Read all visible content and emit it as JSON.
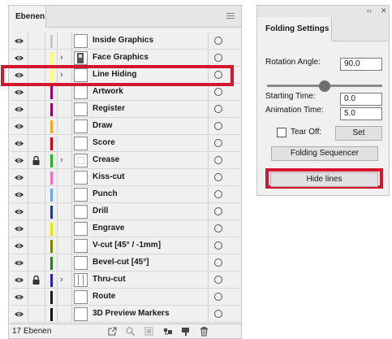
{
  "layers_panel": {
    "tab_label": "Ebenen",
    "menu_icon": "hamburger-icon",
    "layer_count": "17 Ebenen",
    "layers": [
      {
        "name": "Inside Graphics",
        "visible": true,
        "locked": false,
        "expandable": false,
        "color": "#c9c9c9",
        "thumb": "blank"
      },
      {
        "name": "Face Graphics",
        "visible": true,
        "locked": false,
        "expandable": true,
        "color": "#ffff66",
        "thumb": "graphic"
      },
      {
        "name": "Line Hiding",
        "visible": true,
        "locked": false,
        "expandable": true,
        "color": "#ffff66",
        "thumb": "blank",
        "highlighted": true
      },
      {
        "name": "Artwork",
        "visible": true,
        "locked": false,
        "expandable": false,
        "color": "#a0006e",
        "thumb": "blank"
      },
      {
        "name": "Register",
        "visible": true,
        "locked": false,
        "expandable": false,
        "color": "#a0006e",
        "thumb": "blank"
      },
      {
        "name": "Draw",
        "visible": true,
        "locked": false,
        "expandable": false,
        "color": "#ffa020",
        "thumb": "blank"
      },
      {
        "name": "Score",
        "visible": true,
        "locked": false,
        "expandable": false,
        "color": "#d40000",
        "thumb": "blank"
      },
      {
        "name": "Crease",
        "visible": true,
        "locked": true,
        "expandable": true,
        "color": "#1db41d",
        "thumb": "faint"
      },
      {
        "name": "Kiss-cut",
        "visible": true,
        "locked": false,
        "expandable": false,
        "color": "#ff66cc",
        "thumb": "blank"
      },
      {
        "name": "Punch",
        "visible": true,
        "locked": false,
        "expandable": false,
        "color": "#60a8ff",
        "thumb": "blank"
      },
      {
        "name": "Drill",
        "visible": true,
        "locked": false,
        "expandable": false,
        "color": "#1a3c8c",
        "thumb": "blank"
      },
      {
        "name": "Engrave",
        "visible": true,
        "locked": false,
        "expandable": false,
        "color": "#e6e600",
        "thumb": "blank"
      },
      {
        "name": "V-cut [45° / -1mm]",
        "visible": true,
        "locked": false,
        "expandable": false,
        "color": "#808000",
        "thumb": "blank"
      },
      {
        "name": "Bevel-cut [45°]",
        "visible": true,
        "locked": false,
        "expandable": false,
        "color": "#2a7a2a",
        "thumb": "blank"
      },
      {
        "name": "Thru-cut",
        "visible": true,
        "locked": true,
        "expandable": true,
        "color": "#2020d0",
        "thumb": "lines"
      },
      {
        "name": "Route",
        "visible": true,
        "locked": false,
        "expandable": false,
        "color": "#1a1a1a",
        "thumb": "blank"
      },
      {
        "name": "3D Preview Markers",
        "visible": true,
        "locked": false,
        "expandable": false,
        "color": "#111111",
        "thumb": "blank"
      }
    ],
    "footer_icons": [
      "export-icon",
      "search-icon",
      "clipping-mask-icon",
      "new-sublayer-icon",
      "new-layer-icon",
      "delete-icon"
    ]
  },
  "folding_panel": {
    "top_controls": [
      "collapse-icon",
      "close-icon"
    ],
    "top_collapse_label": "‹‹",
    "top_close_label": "✕",
    "tab_label": "Folding Settings",
    "rotation_angle_label": "Rotation Angle:",
    "rotation_angle_value": "90.0",
    "slider_fraction": 0.5,
    "starting_time_label": "Starting Time:",
    "starting_time_value": "0.0",
    "animation_time_label": "Animation Time:",
    "animation_time_value": "5.0",
    "tear_off_label": "Tear Off:",
    "tear_off_checked": false,
    "set_button": "Set",
    "folding_sequencer_button": "Folding Sequencer",
    "hide_lines_button": "Hide lines"
  }
}
